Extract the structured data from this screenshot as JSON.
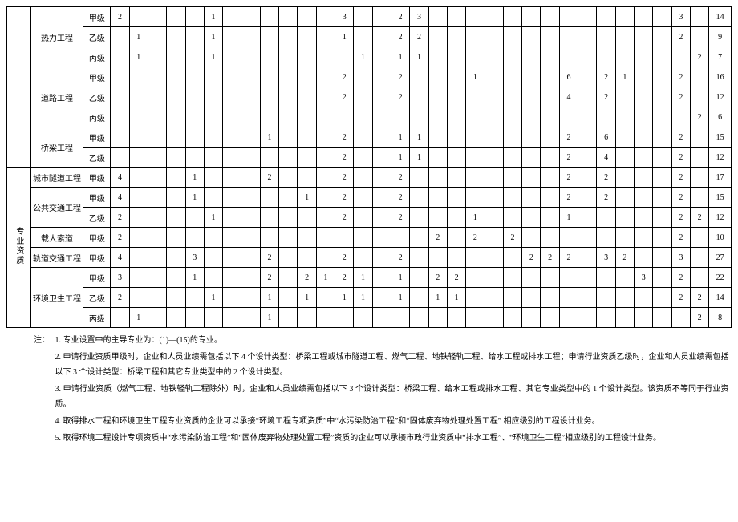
{
  "categories": {
    "pro": "专业资质"
  },
  "row_labels": {
    "rl": "热力工程",
    "dl": "道路工程",
    "ql": "桥梁工程",
    "sd": "城市隧道工程",
    "gg": "公共交通工程",
    "zr": "载人索道",
    "gd": "轨道交通工程",
    "hw": "环境卫生工程"
  },
  "levels": {
    "a": "甲级",
    "b": "乙级",
    "c": "丙级"
  },
  "rows": {
    "rl_a": {
      "1": "2",
      "6": "1",
      "13": "3",
      "16": "2",
      "17": "3",
      "31": "3",
      "33": "14"
    },
    "rl_b": {
      "2": "1",
      "6": "1",
      "13": "1",
      "16": "2",
      "17": "2",
      "31": "2",
      "33": "9"
    },
    "rl_c": {
      "2": "1",
      "6": "1",
      "14": "1",
      "16": "1",
      "17": "1",
      "32": "2",
      "33": "7"
    },
    "dl_a": {
      "13": "2",
      "16": "2",
      "20": "1",
      "25": "6",
      "27": "2",
      "28": "1",
      "31": "2",
      "33": "16"
    },
    "dl_b": {
      "13": "2",
      "16": "2",
      "25": "4",
      "27": "2",
      "31": "2",
      "33": "12"
    },
    "dl_c": {
      "32": "2",
      "33": "6"
    },
    "ql_a": {
      "9": "1",
      "13": "2",
      "16": "1",
      "17": "1",
      "25": "2",
      "27": "6",
      "31": "2",
      "33": "15"
    },
    "ql_b": {
      "13": "2",
      "16": "1",
      "17": "1",
      "25": "2",
      "27": "4",
      "31": "2",
      "33": "12"
    },
    "sd_a": {
      "1": "4",
      "5": "1",
      "9": "2",
      "13": "2",
      "16": "2",
      "25": "2",
      "27": "2",
      "31": "2",
      "33": "17"
    },
    "gg_a": {
      "1": "4",
      "5": "1",
      "11": "1",
      "13": "2",
      "16": "2",
      "25": "2",
      "27": "2",
      "31": "2",
      "33": "15"
    },
    "gg_b": {
      "1": "2",
      "6": "1",
      "13": "2",
      "16": "2",
      "20": "1",
      "25": "1",
      "31": "2",
      "32": "2",
      "33": "12"
    },
    "zr_a": {
      "1": "2",
      "18": "2",
      "20": "2",
      "22": "2",
      "31": "2",
      "33": "10"
    },
    "gd_a": {
      "1": "4",
      "5": "3",
      "9": "2",
      "13": "2",
      "16": "2",
      "23": "2",
      "24": "2",
      "25": "2",
      "27": "3",
      "28": "2",
      "31": "3",
      "33": "27"
    },
    "hw_a": {
      "1": "3",
      "5": "1",
      "9": "2",
      "11": "2",
      "12": "1",
      "13": "2",
      "14": "1",
      "16": "1",
      "18": "2",
      "19": "2",
      "29": "3",
      "31": "2",
      "33": "22"
    },
    "hw_b": {
      "1": "2",
      "6": "1",
      "9": "1",
      "11": "1",
      "13": "1",
      "14": "1",
      "16": "1",
      "18": "1",
      "19": "1",
      "31": "2",
      "32": "2",
      "33": "14"
    },
    "hw_c": {
      "2": "1",
      "9": "1",
      "32": "2",
      "33": "8"
    }
  },
  "notes_label": "注：",
  "notes": [
    "1. 专业设置中的主导专业为：(1)—(15)的专业。",
    "2. 申请行业资质甲级时，企业和人员业绩需包括以下 4 个设计类型：桥梁工程或城市隧道工程、燃气工程、地铁轻轨工程、给水工程或排水工程；申请行业资质乙级时，企业和人员业绩需包括以下 3 个设计类型：桥梁工程和其它专业类型中的 2 个设计类型。",
    "3. 申请行业资质（燃气工程、地铁轻轨工程除外）时，企业和人员业绩需包括以下 3 个设计类型：桥梁工程、给水工程或排水工程、其它专业类型中的 1 个设计类型。该资质不等同于行业资质。",
    "4. 取得排水工程和环境卫生工程专业资质的企业可以承接“环境工程专项资质”中“水污染防治工程”和“固体废弃物处理处置工程”  相应级别的工程设计业务。",
    "5. 取得环境工程设计专项资质中“水污染防治工程”和“固体废弃物处理处置工程”资质的企业可以承接市政行业资质中“排水工程”、“环境卫生工程”相应级别的工程设计业务。"
  ]
}
